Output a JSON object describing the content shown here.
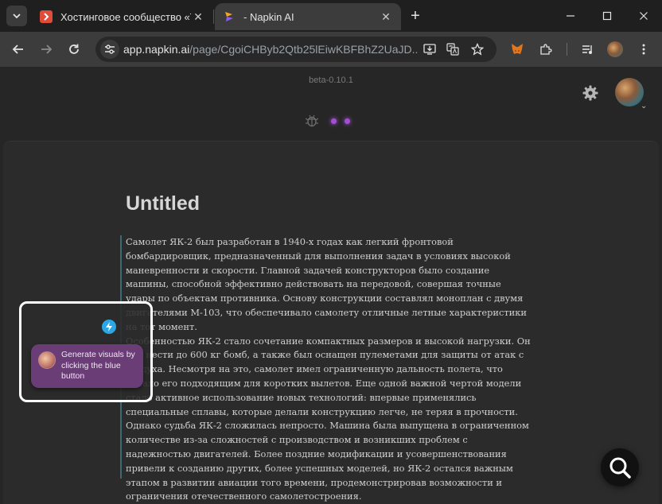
{
  "browser": {
    "tabs": [
      {
        "title": "Хостинговое сообщество «Tim",
        "active": false,
        "favicon_color": "#e04b3a"
      },
      {
        "title": "- Napkin AI",
        "active": true,
        "favicon_color": "#8b5cf6"
      }
    ],
    "new_tab_label": "+",
    "close_label": "✕",
    "url_host": "app.napkin.ai",
    "url_path": "/page/CgoiCHByb2Qtb25lEiwKBFBhZ2UaJD..."
  },
  "app": {
    "version": "beta-0.10.1"
  },
  "document": {
    "title": "Untitled",
    "paragraphs": [
      "Самолет ЯК-2 был разработан в 1940-х годах как легкий фронтовой бомбардировщик, предназначенный для выполнения задач в условиях высокой маневренности и скорости. Главной задачей конструкторов было создание машины, способной эффективно действовать на передовой, совершая точные удары по объектам противника. Основу конструкции составлял моноплан с двумя двигателями М-103, что обеспечивало самолету отличные летные характеристики на тот момент.",
      "Особенностью ЯК-2 стало сочетание компактных размеров и высокой нагрузки. Он мог нести до 600 кг бомб, а также был оснащен пулеметами для защиты от атак с воздуха. Несмотря на это, самолет имел ограниченную дальность полета, что делало его подходящим для коротких вылетов. Еще одной важной чертой модели стало активное использование новых технологий: впервые применялись специальные сплавы, которые делали конструкцию легче, не теряя в прочности.",
      "Однако судьба ЯК-2 сложилась непросто. Машина была выпущена в ограниченном количестве из-за сложностей с производством и возникших проблем с надежностью двигателей. Более поздние модификации и усовершенствования привели к созданию других, более успешных моделей, но ЯК-2 остался важным этапом в развитии авиации того времени, продемонстрировав возможности и ограничения отечественного самолетостроения."
    ]
  },
  "tooltip": {
    "text": "Generate visuals by clicking the blue button"
  },
  "colors": {
    "accent_blue": "#2aa7e4",
    "tooltip_bg": "#6a3d76",
    "status_dot": "#a64bd8"
  }
}
